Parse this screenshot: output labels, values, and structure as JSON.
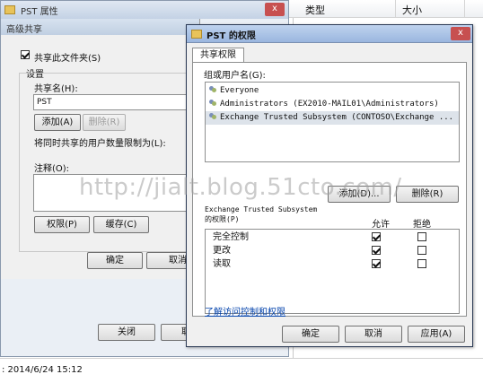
{
  "bg_window": {
    "title": "PST 属性",
    "close": "x"
  },
  "explorer": {
    "columns": [
      "类型",
      "大小"
    ],
    "status_text": ": 2014/6/24 15:12"
  },
  "advanced_sharing": {
    "title": "高级共享",
    "share_checkbox_label": "共享此文件夹(S)",
    "share_checked": true,
    "settings_group": "设置",
    "share_name_label": "共享名(H):",
    "share_name_value": "PST",
    "add_label": "添加(A)",
    "remove_label": "删除(R)",
    "limit_label": "将同时共享的用户数量限制为(L):",
    "comment_label": "注释(O):",
    "permissions_label": "权限(P)",
    "caching_label": "缓存(C)",
    "ok_label": "确定",
    "cancel_label": "取消"
  },
  "properties_buttons": {
    "close_label": "关闭",
    "cancel_partial": "取"
  },
  "perm_dialog": {
    "title": "PST 的权限",
    "close": "x",
    "tab": "共享权限",
    "group_label": "组或用户名(G):",
    "users": [
      "Everyone",
      "Administrators (EX2010-MAIL01\\Administrators)",
      "Exchange Trusted Subsystem (CONTOSO\\Exchange ..."
    ],
    "add_label": "添加(D)...",
    "remove_label": "删除(R)",
    "perm_header_name": "Exchange Trusted Subsystem",
    "perm_header_suffix": "的权限(P)",
    "allow_label": "允许",
    "deny_label": "拒绝",
    "permissions": [
      {
        "name": "完全控制",
        "allow": true,
        "deny": false
      },
      {
        "name": "更改",
        "allow": true,
        "deny": false
      },
      {
        "name": "读取",
        "allow": true,
        "deny": false
      }
    ],
    "link_label": "了解访问控制和权限",
    "ok_label": "确定",
    "cancel_label": "取消",
    "apply_label": "应用(A)"
  },
  "watermark": "http://jialt.blog.51cto.com/"
}
